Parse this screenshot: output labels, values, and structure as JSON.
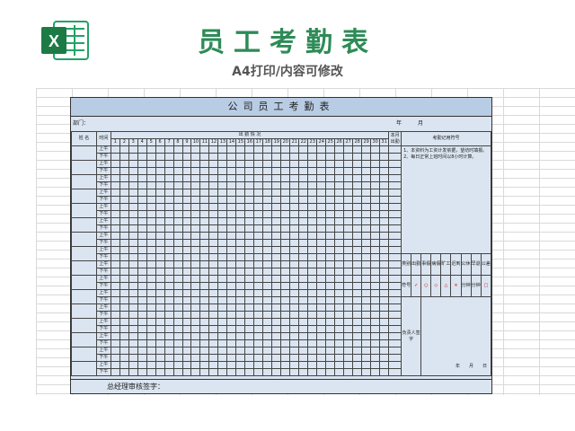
{
  "header": {
    "title": "员工考勤表",
    "subtitle": "A4打印/内容可修改",
    "app_icon": "excel-icon"
  },
  "form": {
    "title": "公司员工考勤表",
    "dept_label": "部门：",
    "year_label": "年",
    "month_label": "月",
    "col_name": "姓 名",
    "col_time": "时间",
    "attend_header": "出 勤 情 况",
    "monthly_header": "本月出勤",
    "legend_title": "考勤记用符号",
    "notes": [
      "1、本资料为工资计发依据，望坊时填报。",
      "2、每日正常上班时间以8小时计算。"
    ],
    "days": [
      "1",
      "2",
      "3",
      "4",
      "5",
      "6",
      "7",
      "8",
      "9",
      "10",
      "11",
      "12",
      "13",
      "14",
      "15",
      "16",
      "17",
      "18",
      "19",
      "20",
      "21",
      "22",
      "23",
      "24",
      "25",
      "26",
      "27",
      "28",
      "29",
      "30",
      "31"
    ],
    "periods": [
      "上午",
      "下午"
    ],
    "row_pairs": 16,
    "categories": [
      "类别",
      "出勤",
      "事假",
      "病假",
      "旷工",
      "迟到",
      "公休",
      "早退",
      "公差"
    ],
    "symbols": [
      "符号",
      "✓",
      "○",
      "◇",
      "△",
      "×",
      "分钟",
      "分钟",
      "□"
    ],
    "supervisor_sign": "负责人签字",
    "date_labels": [
      "年",
      "月",
      "日"
    ],
    "manager_sign": "总经理审核签字："
  }
}
